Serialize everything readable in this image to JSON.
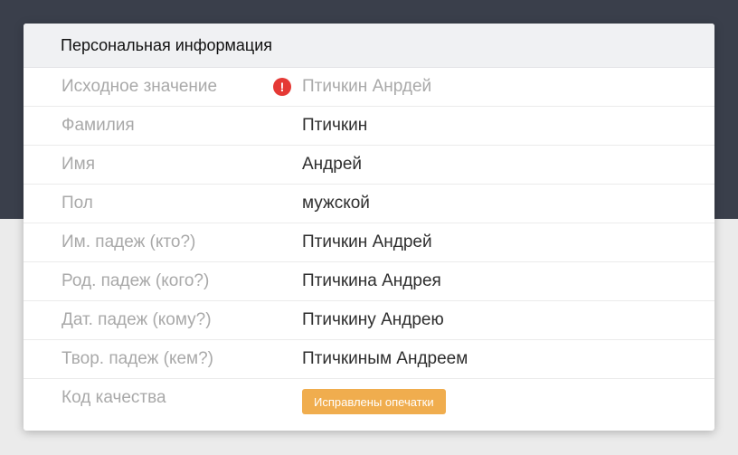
{
  "card": {
    "title": "Персональная информация"
  },
  "rows": [
    {
      "label": "Исходное значение",
      "value": "Птичкин Анрдей",
      "icon": "exclamation-icon"
    },
    {
      "label": "Фамилия",
      "value": "Птичкин"
    },
    {
      "label": "Имя",
      "value": "Андрей"
    },
    {
      "label": "Пол",
      "value": "мужской"
    },
    {
      "label": "Им. падеж (кто?)",
      "value": "Птичкин Андрей"
    },
    {
      "label": "Род. падеж (кого?)",
      "value": "Птичкина Андрея"
    },
    {
      "label": "Дат. падеж (кому?)",
      "value": "Птичкину Андрею"
    },
    {
      "label": "Твор. падеж (кем?)",
      "value": "Птичкиным Андреем"
    },
    {
      "label": "Код качества",
      "badge": "Исправлены опечатки"
    }
  ],
  "colors": {
    "header_bg": "#3a3f4b",
    "warning": "#e53935",
    "badge": "#f0ad4e",
    "label": "#a9a9a9",
    "value": "#2e2e2e"
  }
}
